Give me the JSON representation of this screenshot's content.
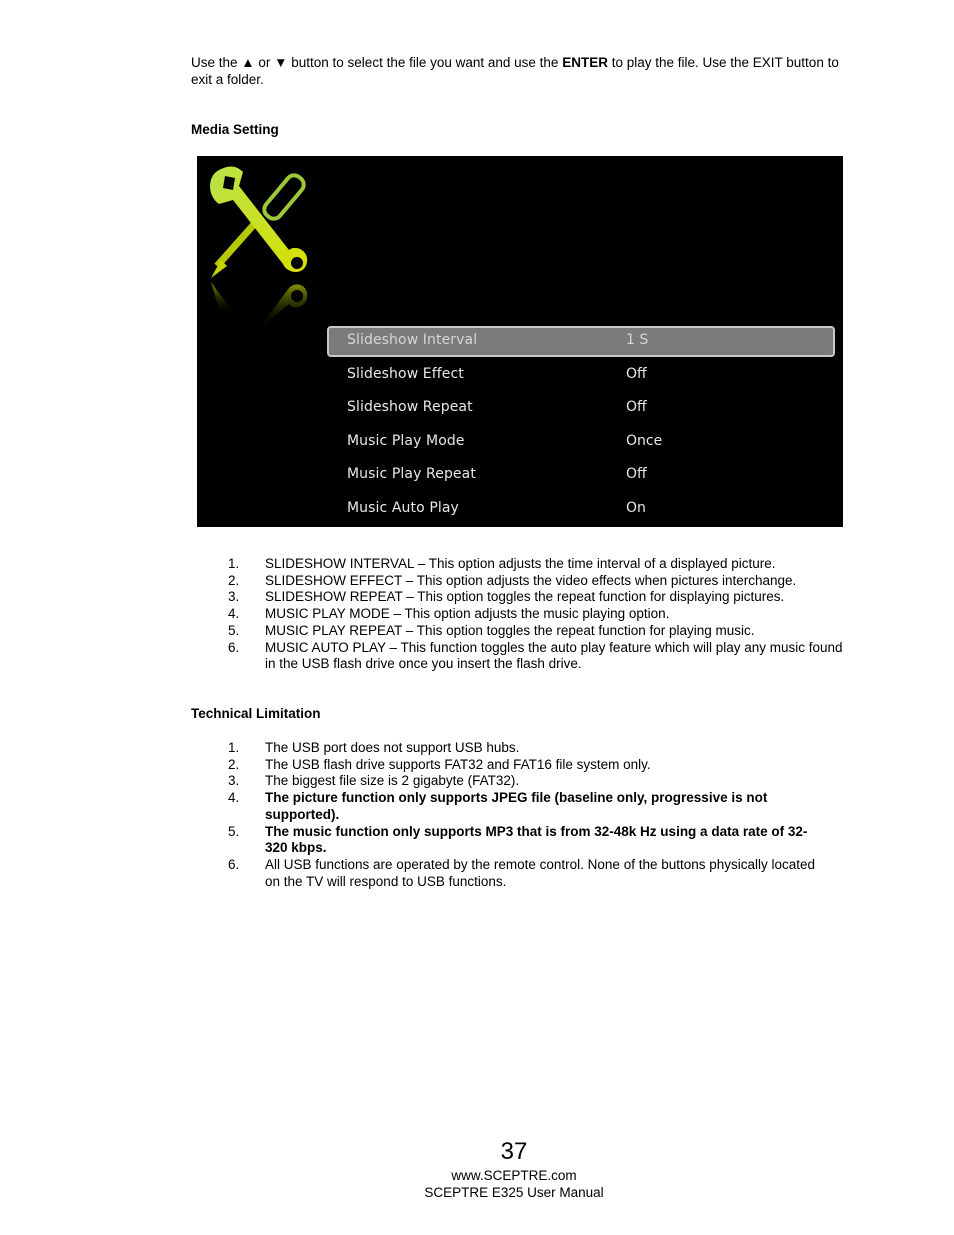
{
  "intro": {
    "part1": "Use the ▲ or ▼ button to select the file you want and use the ",
    "bold": "ENTER",
    "part2": " to play the file.  Use the EXIT button to exit a folder."
  },
  "media_setting": {
    "heading": "Media Setting",
    "screen": {
      "icon": "tools-wrench-screwdriver-icon",
      "menu": [
        {
          "label": "Slideshow Interval",
          "value": "1 S",
          "selected": true
        },
        {
          "label": "Slideshow Effect",
          "value": "Off",
          "selected": false
        },
        {
          "label": "Slideshow Repeat",
          "value": "Off",
          "selected": false
        },
        {
          "label": "Music Play Mode",
          "value": "Once",
          "selected": false
        },
        {
          "label": "Music Play Repeat",
          "value": "Off",
          "selected": false
        },
        {
          "label": "Music Auto Play",
          "value": "On",
          "selected": false
        }
      ]
    },
    "items": [
      {
        "num": "1.",
        "text": "SLIDESHOW INTERVAL – This option adjusts the time interval of a displayed picture."
      },
      {
        "num": "2.",
        "text": "SLIDESHOW EFFECT – This option adjusts the video effects when pictures interchange."
      },
      {
        "num": "3.",
        "text": "SLIDESHOW REPEAT – This option toggles the repeat function for displaying pictures."
      },
      {
        "num": "4.",
        "text": "MUSIC PLAY MODE – This option adjusts the music playing option."
      },
      {
        "num": "5.",
        "text": "MUSIC PLAY REPEAT – This option toggles the repeat function for playing music."
      },
      {
        "num": "6.",
        "text": "MUSIC AUTO PLAY – This function toggles the auto play feature which will play any music found in the USB flash drive once you insert the flash drive."
      }
    ]
  },
  "technical_limitation": {
    "heading": "Technical Limitation",
    "items": [
      {
        "num": "1.",
        "text": "The USB port does not support USB hubs.",
        "bold": false
      },
      {
        "num": "2.",
        "text": "The USB flash drive supports FAT32 and FAT16 file system only.",
        "bold": false
      },
      {
        "num": "3.",
        "text": "The biggest file size is 2 gigabyte (FAT32).",
        "bold": false
      },
      {
        "num": "4.",
        "text": "The picture function only supports JPEG file (baseline only, progressive is not supported).",
        "bold": true
      },
      {
        "num": "5.",
        "text": "The music function only supports MP3 that is from 32-48k Hz using a data rate of 32-320 kbps.",
        "bold": true
      },
      {
        "num": "6.",
        "text": "All USB functions are operated by the remote control.  None of the buttons physically located on the TV will respond to USB functions.",
        "bold": false
      }
    ]
  },
  "footer": {
    "page_number": "37",
    "website": "www.SCEPTRE.com",
    "manual": "SCEPTRE E325 User Manual"
  }
}
